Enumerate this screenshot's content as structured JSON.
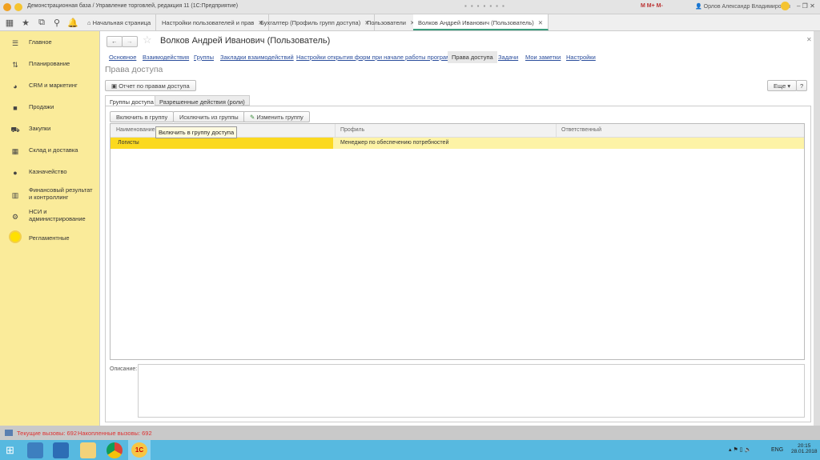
{
  "window": {
    "title": "Демонстрационная база / Управление торговлей, редакция 11  (1С:Предприятие)",
    "user": "Орлов Александр Владимирович",
    "toolbar_icons": [
      "save-icon",
      "print-icon",
      "preview-icon",
      "upload-icon",
      "printer-icon",
      "calendar-icon",
      "calculator-icon"
    ],
    "memory_buttons": [
      "M",
      "M+",
      "M-"
    ]
  },
  "tabs": [
    {
      "label": "Начальная страница",
      "closable": false
    },
    {
      "label": "Настройки пользователей и прав",
      "closable": true
    },
    {
      "label": "Бухгалтер (Профиль групп доступа)",
      "closable": true
    },
    {
      "label": "Пользователи",
      "closable": true
    },
    {
      "label": "Волков Андрей Иванович (Пользователь)",
      "closable": true,
      "active": true
    }
  ],
  "sidebar": {
    "items": [
      {
        "label": "Главное",
        "icon": "menu-icon"
      },
      {
        "label": "Планирование",
        "icon": "planning-icon"
      },
      {
        "label": "CRM и маркетинг",
        "icon": "pie-chart-icon"
      },
      {
        "label": "Продажи",
        "icon": "bag-icon"
      },
      {
        "label": "Закупки",
        "icon": "cart-icon"
      },
      {
        "label": "Склад и доставка",
        "icon": "warehouse-icon"
      },
      {
        "label": "Казначейство",
        "icon": "coin-icon"
      },
      {
        "label": "Финансовый результат и контроллинг",
        "icon": "bar-chart-icon"
      },
      {
        "label": "НСИ и администрирование",
        "icon": "gear-icon"
      },
      {
        "label": "Регламентные",
        "icon": "sun-icon"
      }
    ]
  },
  "form": {
    "title": "Волков Андрей Иванович (Пользователь)",
    "links": [
      "Основное",
      "Взаимодействия",
      "Группы",
      "Закладки взаимодействий",
      "Настройки открытия форм при начале работы программы",
      "Права доступа",
      "Задачи",
      "Мои заметки",
      "Настройки"
    ],
    "active_link": "Права доступа",
    "section_title": "Права доступа",
    "report_button": "Отчет по правам доступа",
    "more_button": "Еще",
    "help_button": "?",
    "inner_tabs": [
      "Группы доступа",
      "Разрешенные действия (роли)"
    ],
    "buttons": {
      "include": "Включить в группу",
      "exclude": "Исключить из группы",
      "edit": "Изменить группу"
    },
    "tooltip": "Включить в группу доступа",
    "table": {
      "columns": [
        "Наименование",
        "Профиль",
        "Ответственный"
      ],
      "rows": [
        [
          "Логисты",
          "Менеджер по обеспечению потребностей",
          ""
        ]
      ]
    },
    "description_label": "Описание:",
    "description_value": ""
  },
  "status": {
    "current": "Текущие вызовы: 692",
    "accumulated": "Накопленные вызовы: 692"
  },
  "taskbar": {
    "lang": "ENG",
    "time": "20:15",
    "date": "28.01.2018"
  },
  "colors": {
    "sidebar": "#faeb9a",
    "selected_row": "#fbd91f",
    "row_highlight": "#fdf3a6",
    "taskbar": "#57b9e0",
    "active_tab_underline": "#3a9e7d"
  }
}
